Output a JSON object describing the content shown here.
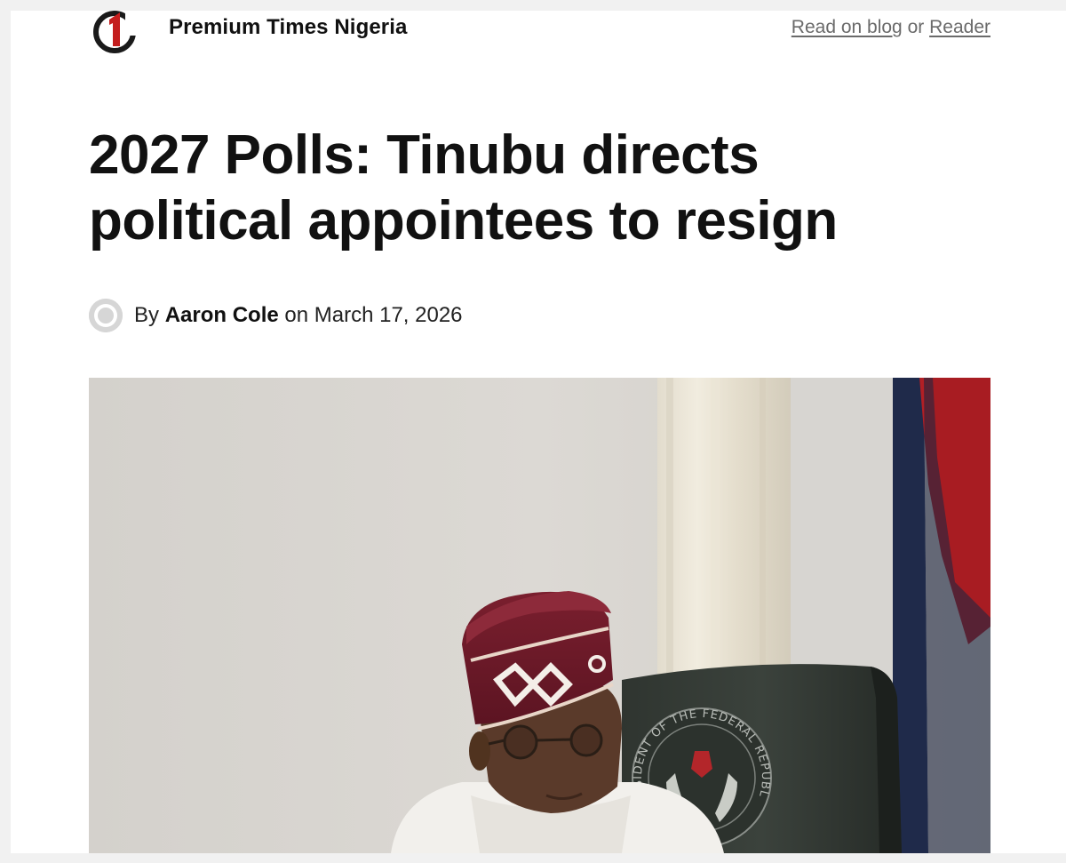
{
  "header": {
    "site_title": "Premium Times Nigeria",
    "read_on_blog": "Read on blog",
    "or_text": "or",
    "reader": "Reader"
  },
  "article": {
    "headline_line1": "2027 Polls: Tinubu directs",
    "headline_line2": "political appointees to resign",
    "byline_prefix": "By",
    "author": "Aaron Cole",
    "byline_on": "on",
    "date": "March 17, 2026"
  },
  "hero_image": {
    "seal_text": "ESIDENT OF THE FEDERAL REPUBLIC"
  },
  "colors": {
    "background": "#f1f1f1",
    "page": "#ffffff",
    "headline": "#111111",
    "link": "#6a6a6a",
    "logo_red": "#c41e1e"
  },
  "icons": {
    "logo": "premium-times-logo",
    "avatar": "default-user-avatar"
  }
}
